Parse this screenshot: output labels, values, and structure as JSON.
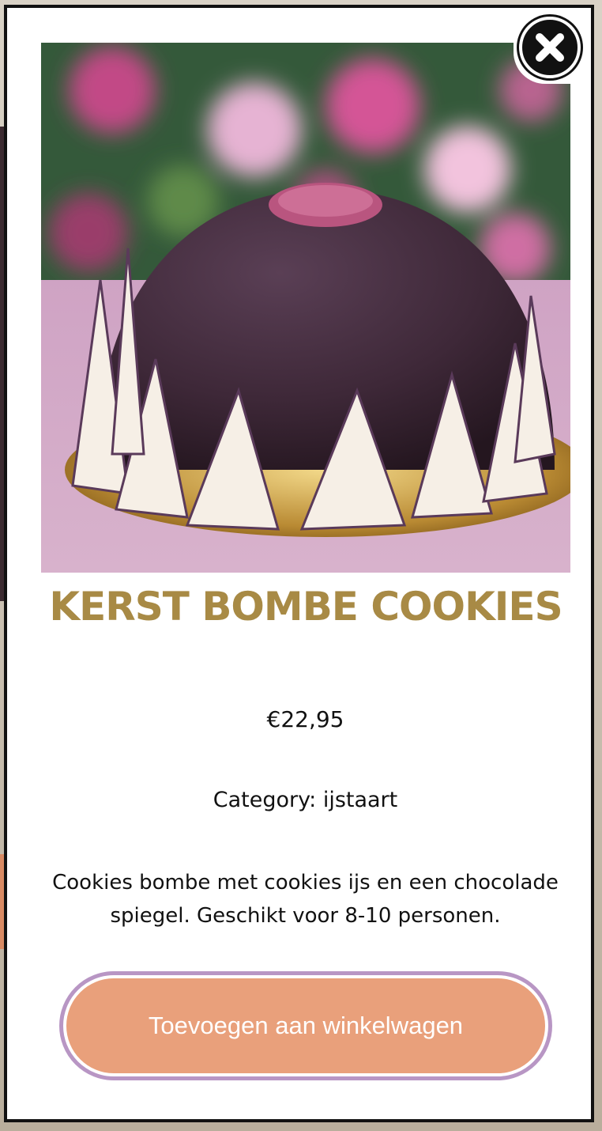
{
  "modal": {
    "close_icon": "close-icon",
    "product": {
      "image_alt": "Kerst bombe cookies",
      "title": "KERST BOMBE COOKIES",
      "price": "€22,95",
      "category_label": "Category:",
      "category_value": "ijstaart",
      "description": "Cookies bombe met cookies ijs en een chocolade spiegel. Geschikt voor 8-10 personen."
    },
    "add_to_cart_label": "Toevoegen aan winkelwagen"
  },
  "colors": {
    "title": "#a88a45",
    "button_fill": "#e9a07b",
    "button_ring": "#b896c4",
    "modal_border": "#111111"
  }
}
